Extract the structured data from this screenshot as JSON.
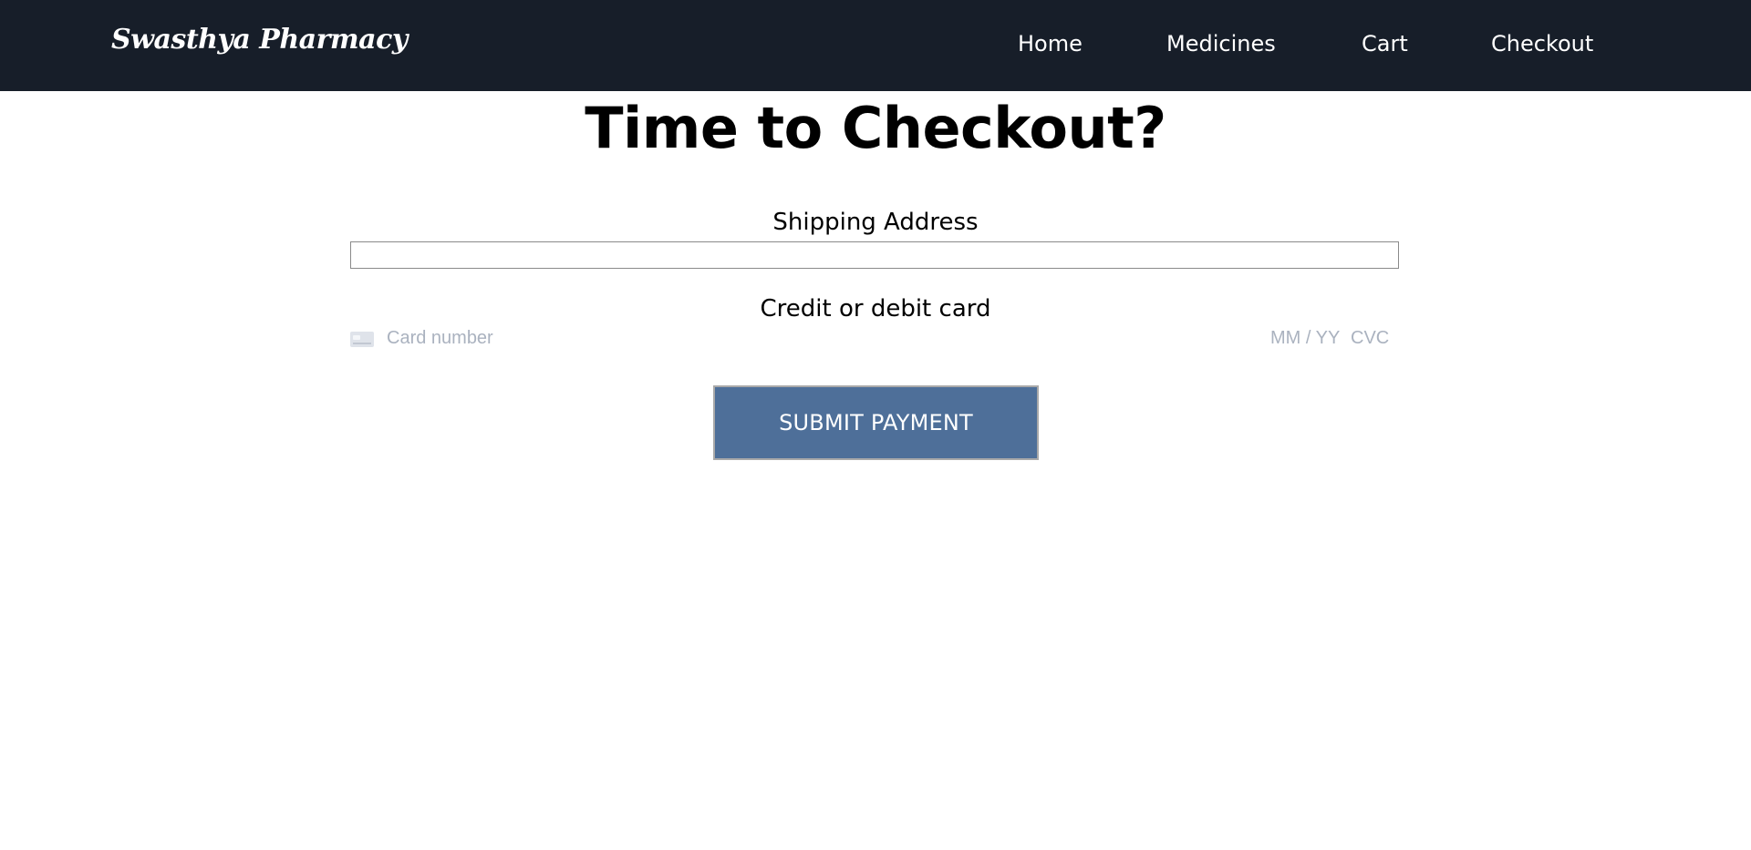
{
  "navbar": {
    "brand": "Swasthya Pharmacy",
    "links": [
      "Home",
      "Medicines",
      "Cart",
      "Checkout"
    ]
  },
  "main": {
    "title": "Time to Checkout?",
    "shipping_label": "Shipping Address",
    "shipping_value": "",
    "card_label": "Credit or debit card",
    "card_number_placeholder": "Card number",
    "card_expiry_placeholder": "MM / YY",
    "card_cvc_placeholder": "CVC",
    "card_icon": "credit-card-icon",
    "submit_label": "SUBMIT PAYMENT"
  },
  "colors": {
    "navbar_bg": "#171e29",
    "button_bg": "#4e6f99",
    "placeholder": "#aab2bf"
  }
}
